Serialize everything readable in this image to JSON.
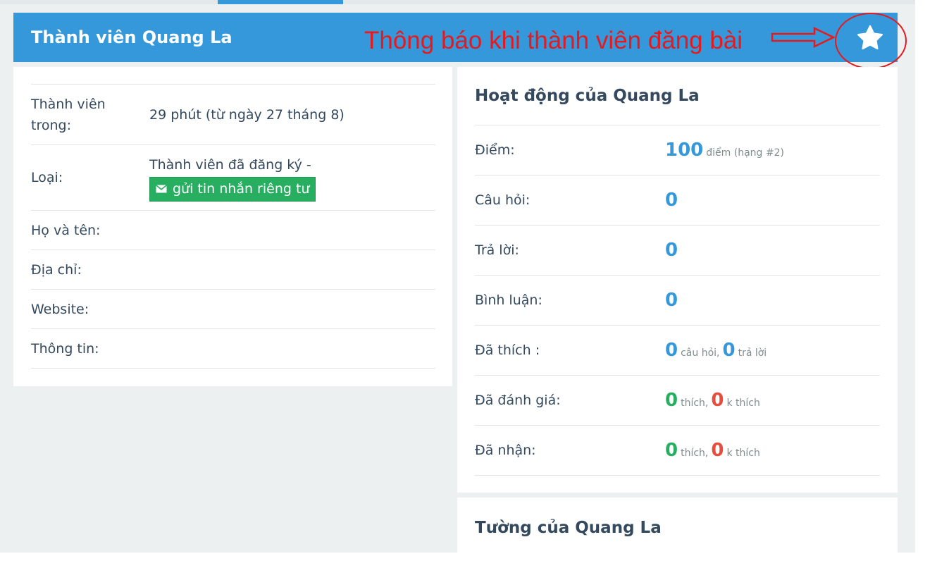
{
  "header": {
    "title": "Thành viên Quang La",
    "favorite_icon": "star-icon"
  },
  "annotation": {
    "text": "Thông báo khi thành viên đăng bài",
    "color": "#e8191c"
  },
  "profile": {
    "rows": [
      {
        "label": "Thành viên trong:",
        "value": "29 phút (từ ngày 27 tháng 8)"
      },
      {
        "label": "Loại:",
        "value": "Thành viên đã đăng ký -",
        "button": "gửi tin nhắn riêng tư"
      },
      {
        "label": "Họ và tên:",
        "value": ""
      },
      {
        "label": "Địa chỉ:",
        "value": ""
      },
      {
        "label": "Website:",
        "value": ""
      },
      {
        "label": "Thông tin:",
        "value": ""
      }
    ]
  },
  "activity": {
    "title": "Hoạt động của Quang La",
    "points": {
      "label": "Điểm:",
      "value": "100",
      "unit": "điểm (hạng #2)"
    },
    "questions": {
      "label": "Câu hỏi:",
      "value": "0"
    },
    "answers": {
      "label": "Trả lời:",
      "value": "0"
    },
    "comments": {
      "label": "Bình luận:",
      "value": "0"
    },
    "liked": {
      "label": "Đã thích :",
      "q_value": "0",
      "q_unit": "câu hỏi,",
      "a_value": "0",
      "a_unit": "trả lời"
    },
    "rated": {
      "label": "Đã đánh giá:",
      "up_value": "0",
      "up_unit": "thích,",
      "down_value": "0",
      "down_unit": "k thích"
    },
    "received": {
      "label": "Đã nhận:",
      "up_value": "0",
      "up_unit": "thích,",
      "down_value": "0",
      "down_unit": "k thích"
    }
  },
  "wall": {
    "title": "Tường của Quang La"
  },
  "colors": {
    "primary": "#3498db",
    "success": "#27ae60",
    "danger": "#e74c3c",
    "text": "#34495e"
  }
}
